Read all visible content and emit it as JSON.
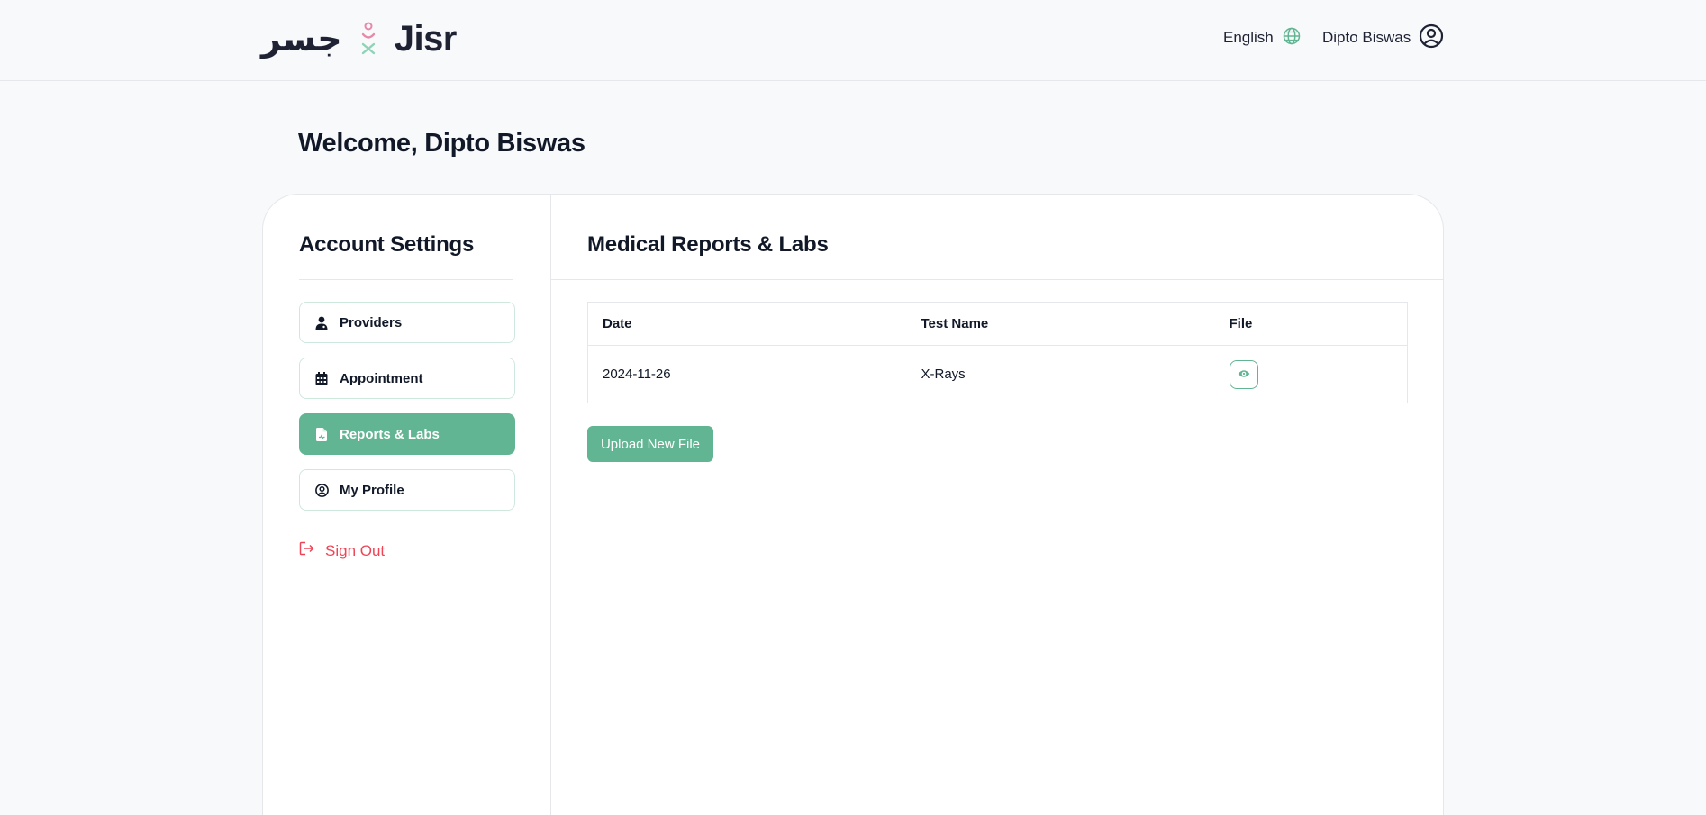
{
  "header": {
    "logo_arabic": "جسر",
    "logo_latin": "Jisr",
    "language": "English",
    "user_name": "Dipto Biswas"
  },
  "welcome": "Welcome, Dipto Biswas",
  "sidebar": {
    "title": "Account Settings",
    "items": [
      {
        "label": "Providers",
        "icon": "user-doctor-icon",
        "active": false
      },
      {
        "label": "Appointment",
        "icon": "calendar-icon",
        "active": false
      },
      {
        "label": "Reports & Labs",
        "icon": "file-medical-icon",
        "active": true
      },
      {
        "label": "My Profile",
        "icon": "user-circle-icon",
        "active": false
      }
    ],
    "sign_out": "Sign Out"
  },
  "main": {
    "title": "Medical Reports & Labs",
    "columns": [
      "Date",
      "Test Name",
      "File"
    ],
    "rows": [
      {
        "date": "2024-11-26",
        "test_name": "X-Rays",
        "file_icon": "eye-icon"
      }
    ],
    "upload_label": "Upload New File"
  },
  "colors": {
    "accent": "#62b592",
    "danger": "#ef4455",
    "text": "#111827",
    "border": "#e5e7eb",
    "background": "#f8f9fb"
  }
}
